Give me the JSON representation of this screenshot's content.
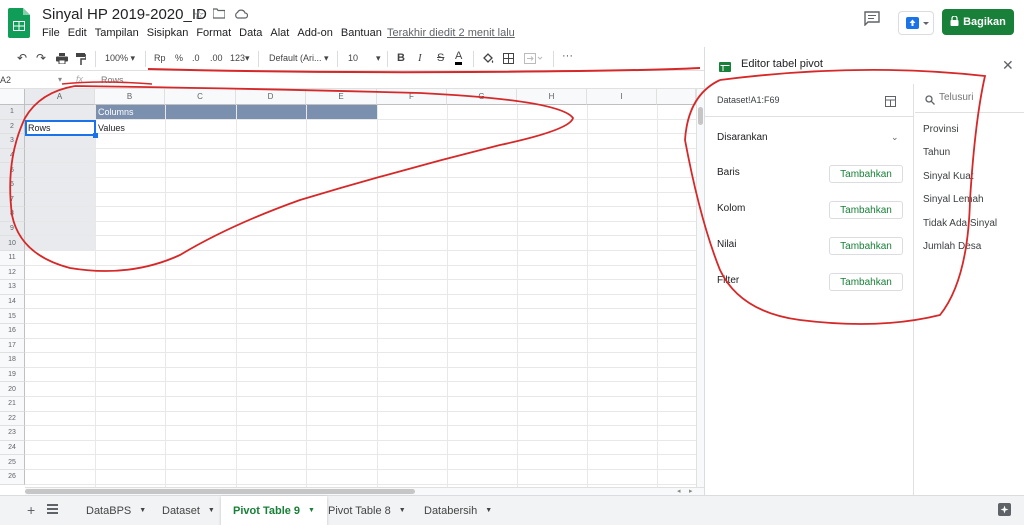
{
  "header": {
    "title": "Sinyal HP 2019-2020_ID",
    "menu": [
      "File",
      "Edit",
      "Tampilan",
      "Sisipkan",
      "Format",
      "Data",
      "Alat",
      "Add-on",
      "Bantuan"
    ],
    "last_edit": "Terakhir diedit 2 menit lalu",
    "share_label": "Bagikan"
  },
  "toolbar": {
    "zoom": "100%",
    "currency": "Rp",
    "percent": "%",
    "dec_decrease": ".0",
    "dec_increase": ".00",
    "more_formats": "123",
    "font": "Default (Ari...",
    "font_size": "10",
    "bold": "B",
    "italic": "I",
    "strike": "S",
    "text_color": "A",
    "more": "···"
  },
  "formula_bar": {
    "cell_ref": "A2",
    "fx": "fx",
    "value": "Rows"
  },
  "grid": {
    "columns": [
      "A",
      "B",
      "C",
      "D",
      "E",
      "F",
      "G",
      "H",
      "I"
    ],
    "rows": [
      "1",
      "2",
      "3",
      "4",
      "5",
      "6",
      "7",
      "8",
      "9",
      "10",
      "11",
      "12",
      "13",
      "14",
      "15",
      "16",
      "17",
      "18",
      "19",
      "20",
      "21",
      "22",
      "23",
      "24",
      "25",
      "26"
    ],
    "cells": {
      "b1": "Columns",
      "a2": "Rows",
      "b2": "Values"
    }
  },
  "pivot_editor": {
    "title": "Editor tabel pivot",
    "range": "Dataset!A1:F69",
    "suggested": "Disarankan",
    "sections": [
      {
        "label": "Baris",
        "button": "Tambahkan"
      },
      {
        "label": "Kolom",
        "button": "Tambahkan"
      },
      {
        "label": "Nilai",
        "button": "Tambahkan"
      },
      {
        "label": "Filter",
        "button": "Tambahkan"
      }
    ],
    "search_placeholder": "Telusuri",
    "fields": [
      "Provinsi",
      "Tahun",
      "Sinyal Kuat",
      "Sinyal Lemah",
      "Tidak Ada Sinyal",
      "Jumlah Desa"
    ]
  },
  "tabs": [
    {
      "label": "DataBPS"
    },
    {
      "label": "Dataset"
    },
    {
      "label": "Pivot Table 9"
    },
    {
      "label": "Pivot Table 8"
    },
    {
      "label": "Databersih"
    }
  ],
  "colors": {
    "accent_green": "#188038",
    "header_blue": "#7b8fae",
    "annotation_red": "#d62828"
  }
}
